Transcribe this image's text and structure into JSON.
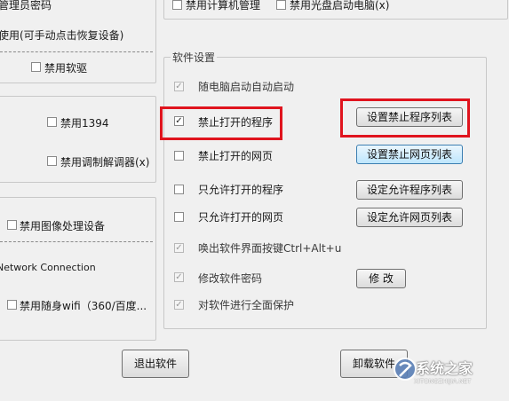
{
  "left_panel": {
    "admin_password_label": "管理员密码",
    "manual_restore_label": "使用(可手动点击恢复设备)",
    "disable_floppy": "禁用软驱",
    "disable_1394": "禁用1394",
    "disable_modem": "禁用调制解调器(x)",
    "disable_imaging": "禁用图像处理设备",
    "network_connection": "Network Connection",
    "disable_portable_wifi": "禁用随身wifi（360/百度..."
  },
  "top_right": {
    "disable_computer_management": "禁用计算机管理",
    "disable_cd_boot": "禁用光盘启动电脑(x)"
  },
  "software_settings": {
    "title": "软件设置",
    "items": [
      {
        "label": "随电脑启动自动启动",
        "checked": true,
        "disabled": true
      },
      {
        "label": "禁止打开的程序",
        "checked": true,
        "disabled": false,
        "button": "设置禁止程序列表"
      },
      {
        "label": "禁止打开的网页",
        "checked": false,
        "disabled": false,
        "button": "设置禁止网页列表"
      },
      {
        "label": "只允许打开的程序",
        "checked": false,
        "disabled": false,
        "button": "设定允许程序列表"
      },
      {
        "label": "只允许打开的网页",
        "checked": false,
        "disabled": false,
        "button": "设定允许网页列表"
      },
      {
        "label": "唤出软件界面按键Ctrl+Alt+u",
        "checked": true,
        "disabled": true
      },
      {
        "label": "修改软件密码",
        "checked": true,
        "disabled": true,
        "button": "修 改"
      },
      {
        "label": "对软件进行全面保护",
        "checked": true,
        "disabled": true
      }
    ]
  },
  "bottom": {
    "exit_button": "退出软件",
    "uninstall_button": "卸载软件"
  },
  "watermark": {
    "text": "系统之家",
    "sub": "XITONGZHIJIA.NET"
  },
  "colors": {
    "highlight_red": "#e0141e",
    "hover_button": "#bee6fd"
  }
}
